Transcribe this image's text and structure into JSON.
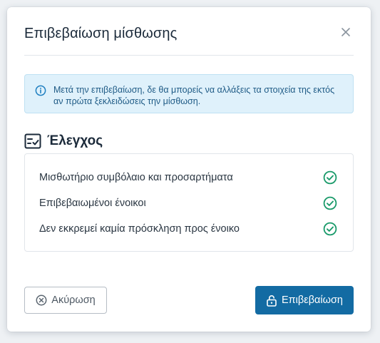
{
  "modal": {
    "title": "Επιβεβαίωση μίσθωσης",
    "close_icon": "close-icon"
  },
  "info": {
    "icon": "info-circle-icon",
    "text": "Μετά την επιβεβαίωση, δε θα μπορείς να αλλάξεις τα στοιχεία της εκτός αν πρώτα ξεκλειδώσεις την μίσθωση."
  },
  "checklist": {
    "icon": "checklist-icon",
    "title": "Έλεγχος",
    "items": [
      {
        "label": "Μισθωτήριο συμβόλαιο και προσαρτήματα",
        "status_icon": "check-circle-icon"
      },
      {
        "label": "Επιβεβαιωμένοι ένοικοι",
        "status_icon": "check-circle-icon"
      },
      {
        "label": "Δεν εκκρεμεί καμία πρόσκληση προς ένοικο",
        "status_icon": "check-circle-icon"
      }
    ]
  },
  "actions": {
    "cancel_label": "Ακύρωση",
    "cancel_icon": "x-circle-icon",
    "confirm_label": "Επιβεβαίωση",
    "confirm_icon": "unlock-icon"
  },
  "colors": {
    "primary": "#136ba3",
    "success": "#1a9a6a",
    "info_bg": "#dff1fb",
    "info_text": "#1f5b86"
  }
}
